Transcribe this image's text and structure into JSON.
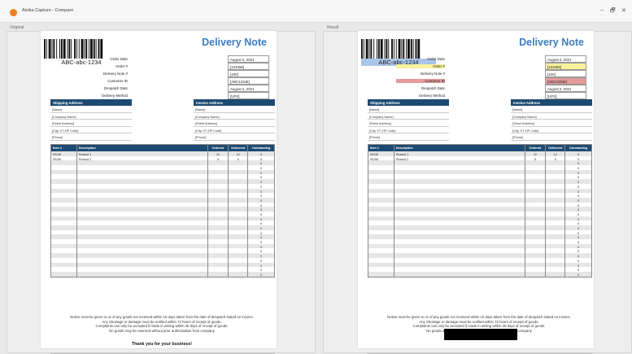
{
  "window": {
    "title": "Aivika Capture - Compare",
    "minimize_glyph": "–",
    "restore_glyph": "🗗",
    "close_glyph": "✕"
  },
  "panes": {
    "original_label": "Original",
    "result_label": "Result"
  },
  "doc": {
    "title": "Delivery Note",
    "barcode_text": "ABC-abc-1234",
    "info": [
      {
        "label": "Order Date",
        "value": "August 2, 2021"
      },
      {
        "label": "Order #",
        "value": "[123456]"
      },
      {
        "label": "Delivery Note #",
        "value": "[100]"
      },
      {
        "label": "Customer ID",
        "value": "[ABC12345]"
      },
      {
        "label": "Despatch Date",
        "value": "August 2, 2021"
      },
      {
        "label": "Delivery Method",
        "value": "[UPS]"
      }
    ],
    "shipping_head": "Shipping Address",
    "invoice_head": "Invoice Address",
    "shipping": [
      "[Name]",
      "[Company Name]",
      "[Street Address]",
      "[City, ST  ZIP Code]",
      "[Phone]"
    ],
    "invoice": [
      "[Name]",
      "[Company Name]",
      "[Street Address]",
      "[City, ST  ZIP Code]",
      "[Phone]"
    ],
    "columns": [
      "Item #",
      "Description",
      "Ordered",
      "Delivered",
      "Outstanding"
    ],
    "items": [
      {
        "item": "00145",
        "desc": "Product 1",
        "ordered": "12",
        "delivered": "12",
        "outstanding": "0"
      },
      {
        "item": "00155",
        "desc": "Product 2",
        "ordered": "5",
        "delivered": "5",
        "outstanding": "0"
      }
    ],
    "empty_outstanding": "0",
    "notice": [
      "Notice must be given to us of any goods not received within 10 days taken from the date of despatch stated on invoice.",
      "Any Shortage or damage must be notified within 72 hours of receipt of goods.",
      "Complaints can only be accepted if made in writing within 30 days of receipt of goods.",
      "No goods may be returned without prior authorisation from company"
    ],
    "thanks": "Thank you for your business!"
  },
  "result_doc": {
    "notice": [
      "Notice must be given to us of any goods not received within 10 days taken from the date of despatch stated on invoice.",
      "Any Shortage or damage must be notified within 72 hours of receipt of goods.",
      "Complaints can only be accepted if made in writing within 30 days of receipt of goods.",
      "No goods may be returned without prior authorisation from company"
    ]
  },
  "highlight_colors": {
    "barcode": "#a9c6e8",
    "order": "#fbf29c",
    "customer": "#e79a9a"
  }
}
